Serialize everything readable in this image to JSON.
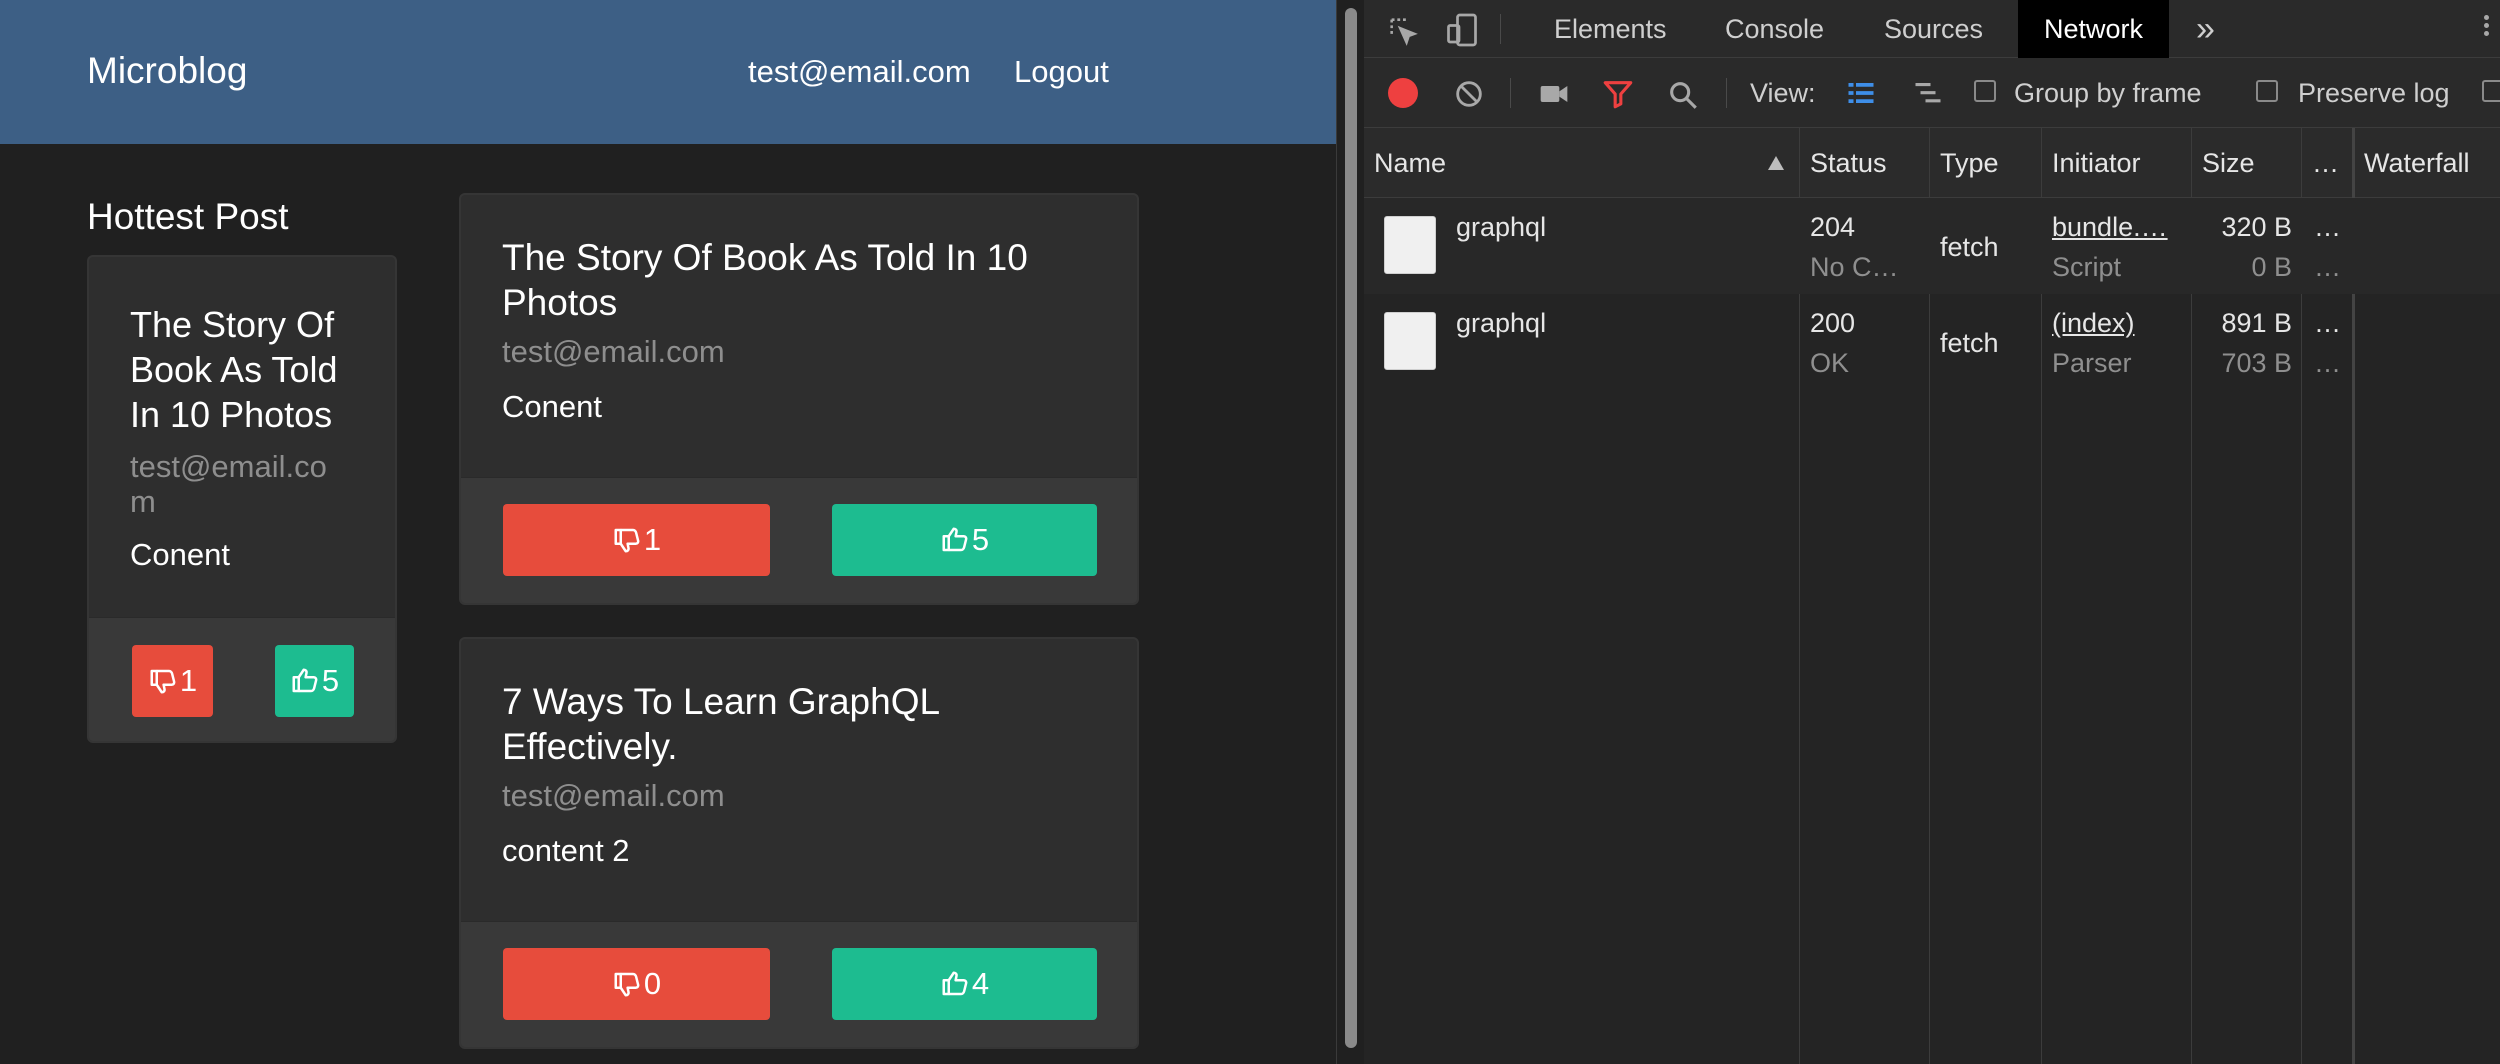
{
  "app": {
    "brand": "Microblog",
    "nav": {
      "email": "test@email.com",
      "logout": "Logout"
    },
    "hottest": {
      "heading": "Hottest Post",
      "title": "The Story Of Book As Told In 10 Photos",
      "author_line1": "test@email.co",
      "author_line2": "m",
      "content": "Conent",
      "downvotes": "1",
      "upvotes": "5"
    },
    "posts": [
      {
        "title_line1": "The Story Of Book As Told In 10",
        "title_line2": "Photos",
        "author": "test@email.com",
        "content": "Conent",
        "downvotes": "1",
        "upvotes": "5"
      },
      {
        "title_line1": "7 Ways To Learn GraphQL",
        "title_line2": "Effectively.",
        "author": "test@email.com",
        "content": "content 2",
        "downvotes": "0",
        "upvotes": "4"
      }
    ],
    "colors": {
      "navbar": "#3d5f85",
      "downvote": "#e74c3c",
      "upvote": "#1dbc90"
    }
  },
  "devtools": {
    "tabs": [
      "Elements",
      "Console",
      "Sources",
      "Network"
    ],
    "active_tab": "Network",
    "more_tabs": "»",
    "toolbar": {
      "view_label": "View:",
      "group_by_frame": "Group by frame",
      "preserve_log": "Preserve log"
    },
    "columns": {
      "name": "Name",
      "status": "Status",
      "type": "Type",
      "initiator": "Initiator",
      "size": "Size",
      "more": "…",
      "waterfall": "Waterfall"
    },
    "rows": [
      {
        "name": "graphql",
        "status": "204",
        "status_text": "No C…",
        "type": "fetch",
        "initiator": "bundle.…",
        "initiator_type": "Script",
        "size": "320 B",
        "resource_size": "0 B",
        "more1": "…",
        "more2": "…"
      },
      {
        "name": "graphql",
        "status": "200",
        "status_text": "OK",
        "type": "fetch",
        "initiator": "(index)",
        "initiator_type": "Parser",
        "size": "891 B",
        "resource_size": "703 B",
        "more1": "…",
        "more2": "…"
      }
    ],
    "icons": [
      "inspect-icon",
      "device-toolbar-icon",
      "record-icon",
      "clear-icon",
      "screenshot-icon",
      "filter-icon",
      "search-icon",
      "list-view-icon",
      "waterfall-view-icon",
      "kebab-menu-icon",
      "sort-asc-icon"
    ]
  }
}
